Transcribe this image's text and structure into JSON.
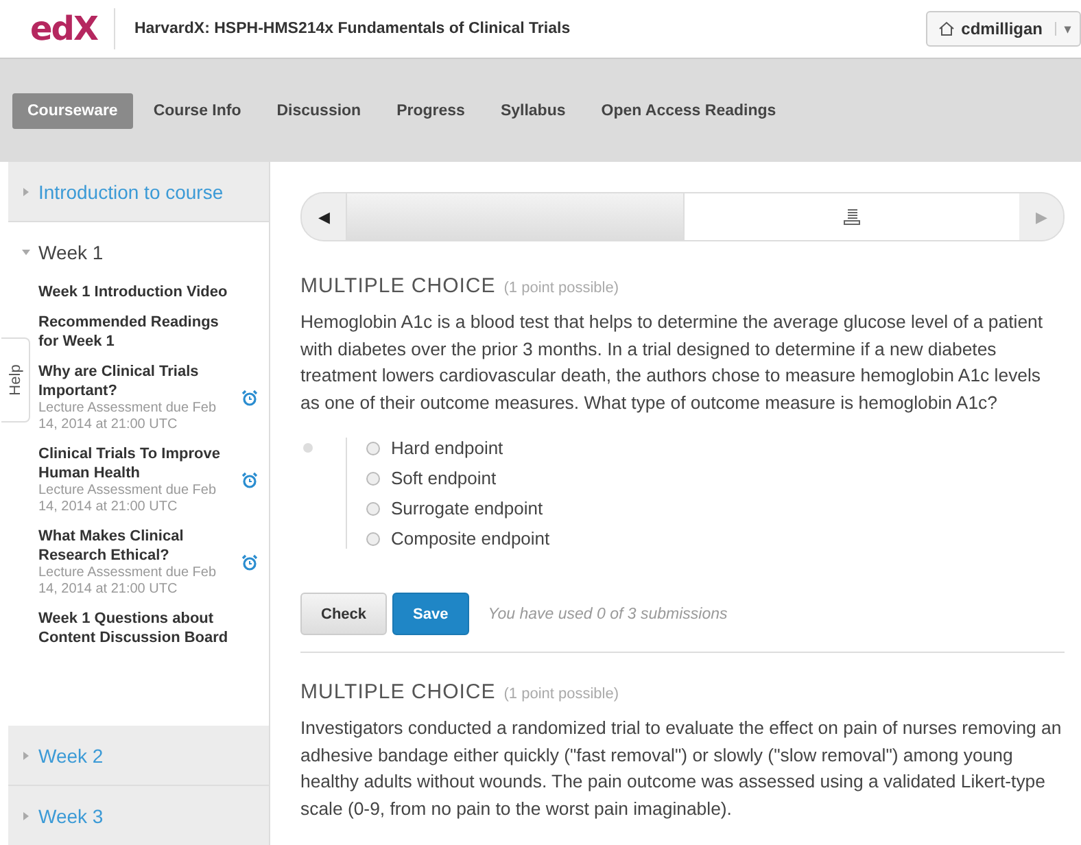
{
  "header": {
    "logo": "edX",
    "course_title": "HarvardX: HSPH-HMS214x Fundamentals of Clinical Trials",
    "user": "cdmilligan",
    "user_menu_caret": "▾"
  },
  "tabs": [
    {
      "label": "Courseware",
      "selected": true
    },
    {
      "label": "Course Info",
      "selected": false
    },
    {
      "label": "Discussion",
      "selected": false
    },
    {
      "label": "Progress",
      "selected": false
    },
    {
      "label": "Syllabus",
      "selected": false
    },
    {
      "label": "Open Access Readings",
      "selected": false
    }
  ],
  "help_tab": "Help",
  "sidebar": {
    "sections": [
      {
        "title": "Introduction to course",
        "expanded": false
      },
      {
        "title": "Week 1",
        "expanded": true,
        "children": [
          {
            "title": "Week 1 Introduction Video",
            "alarm": false
          },
          {
            "title": "Recommended Readings for Week 1",
            "alarm": false
          },
          {
            "title": "Why are Clinical Trials Important?",
            "due": "Lecture Assessment due Feb 14, 2014 at 21:00 UTC",
            "alarm": true
          },
          {
            "title": "Clinical Trials To Improve Human Health",
            "due": "Lecture Assessment due Feb 14, 2014 at 21:00 UTC",
            "alarm": true
          },
          {
            "title": "What Makes Clinical Research Ethical?",
            "due": "Lecture Assessment due Feb 14, 2014 at 21:00 UTC",
            "alarm": true
          },
          {
            "title": "Week 1 Questions about Content Discussion Board",
            "alarm": false
          }
        ]
      },
      {
        "title": "Week 2",
        "expanded": false
      },
      {
        "title": "Week 3",
        "expanded": false
      }
    ]
  },
  "sequence": {
    "prev": "◀",
    "next": "▶",
    "items": [
      {
        "kind": "blank",
        "selected": false
      },
      {
        "kind": "list",
        "selected": true
      }
    ]
  },
  "problems": [
    {
      "heading": "MULTIPLE CHOICE",
      "points": "(1 point possible)",
      "text": "Hemoglobin A1c is a blood test that helps to determine the average glucose level of a patient with diabetes over the prior 3 months. In a trial designed to determine if a new diabetes treatment lowers cardiovascular death, the authors chose to measure hemoglobin A1c levels as one of their outcome measures. What type of outcome measure is hemoglobin A1c?",
      "options": [
        {
          "label": "Hard endpoint",
          "selected": false
        },
        {
          "label": "Soft endpoint",
          "selected": false
        },
        {
          "label": "Surrogate endpoint",
          "selected": false
        },
        {
          "label": "Composite endpoint",
          "selected": false
        }
      ],
      "buttons": [
        {
          "label": "Check",
          "kind": "secondary"
        },
        {
          "label": "Save",
          "kind": "primary"
        }
      ],
      "submissions": "You have used 0 of 3 submissions"
    },
    {
      "heading": "MULTIPLE CHOICE",
      "points": "(1 point possible)",
      "text": "Investigators conducted a randomized trial to evaluate the effect on pain of nurses removing an adhesive bandage either quickly (\"fast removal\") or slowly (\"slow removal\") among young healthy adults without wounds. The pain outcome was assessed using a validated Likert-type scale (0-9, from no pain to the worst pain imaginable)."
    }
  ]
}
